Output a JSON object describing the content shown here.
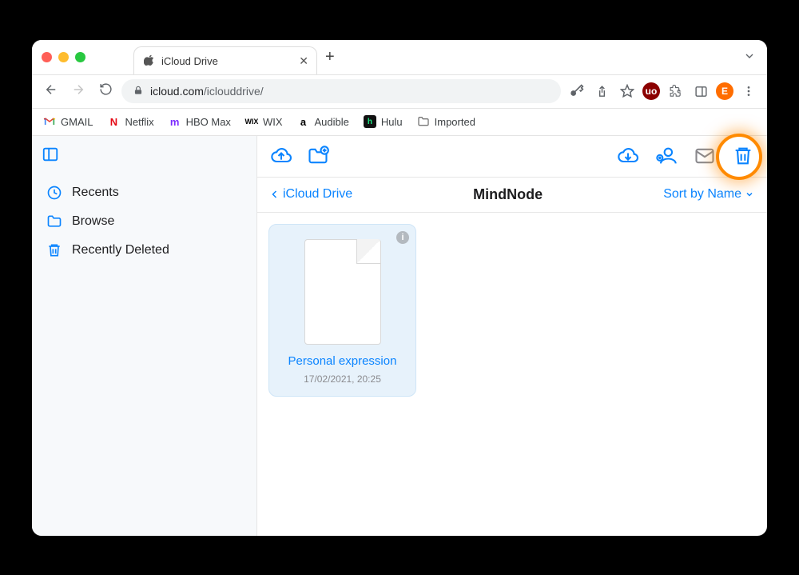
{
  "browser": {
    "tab_title": "iCloud Drive",
    "url_host": "icloud.com",
    "url_path": "/iclouddrive/",
    "new_tab_tooltip": "+",
    "avatar_initial": "E"
  },
  "bookmarks": [
    {
      "label": "GMAIL",
      "icon": "gmail"
    },
    {
      "label": "Netflix",
      "icon": "netflix"
    },
    {
      "label": "HBO Max",
      "icon": "hbo"
    },
    {
      "label": "WIX",
      "icon": "wix"
    },
    {
      "label": "Audible",
      "icon": "audible"
    },
    {
      "label": "Hulu",
      "icon": "hulu"
    },
    {
      "label": "Imported",
      "icon": "folder"
    }
  ],
  "sidebar": {
    "items": [
      {
        "label": "Recents",
        "icon": "clock"
      },
      {
        "label": "Browse",
        "icon": "folder"
      },
      {
        "label": "Recently Deleted",
        "icon": "trash"
      }
    ]
  },
  "breadcrumb": {
    "back_label": "iCloud Drive",
    "title": "MindNode",
    "sort_label": "Sort by Name"
  },
  "files": [
    {
      "name": "Personal expression",
      "date": "17/02/2021, 20:25"
    }
  ]
}
